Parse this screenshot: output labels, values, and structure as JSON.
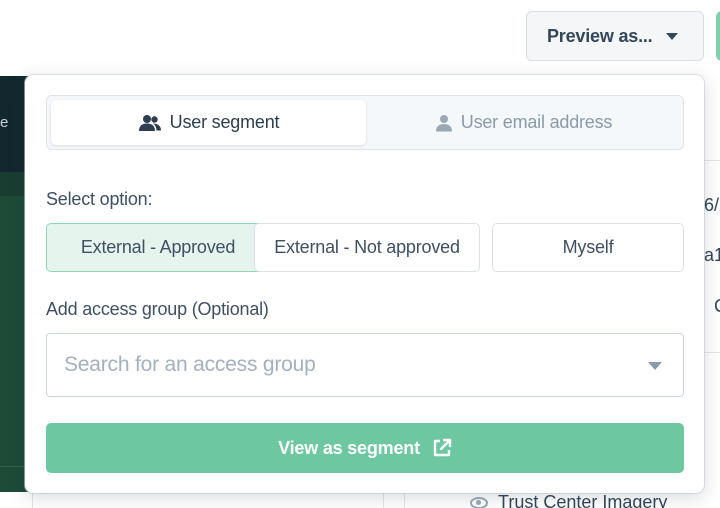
{
  "topbar": {
    "preview_button_label": "Preview as..."
  },
  "background": {
    "sidebar_letter": "e",
    "right_fragments": [
      "6/",
      "a1",
      "C"
    ],
    "bottom_item_label": "Trust Center Imagery"
  },
  "popover": {
    "tabs": [
      {
        "label": "User segment",
        "icon": "users-icon",
        "active": true
      },
      {
        "label": "User email address",
        "icon": "user-icon",
        "active": false
      }
    ],
    "select_option_label": "Select option:",
    "options": [
      {
        "label": "External - Approved",
        "selected": true
      },
      {
        "label": "External - Not approved",
        "selected": false
      },
      {
        "label": "Myself",
        "selected": false
      }
    ],
    "access_group_label": "Add access group (Optional)",
    "access_group_search": {
      "placeholder": "Search for an access group",
      "value": ""
    },
    "view_button_label": "View as segment",
    "view_button_icon": "external-link-icon"
  },
  "colors": {
    "accent": "#6dc8a2",
    "selected_option_bg": "#e5f5ee",
    "selected_option_border": "#8fd5b5",
    "sidebar_dark": "#12282e",
    "sidebar_green": "#1d4b38"
  }
}
